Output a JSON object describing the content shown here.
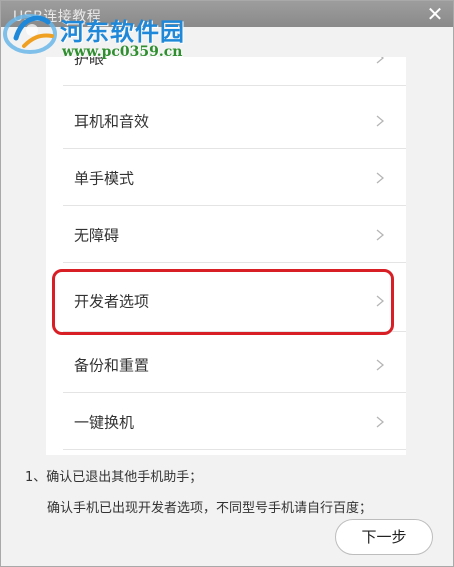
{
  "window": {
    "title": "USB连接教程",
    "close_glyph": "✕"
  },
  "watermark": {
    "title": "河东软件园",
    "url": "www.pc0359.cn"
  },
  "settings_list": [
    {
      "label": "护眼"
    },
    {
      "label": "耳机和音效"
    },
    {
      "label": "单手模式"
    },
    {
      "label": "无障碍"
    },
    {
      "label": "开发者选项"
    },
    {
      "label": "备份和重置"
    },
    {
      "label": "一键换机"
    }
  ],
  "highlight": {
    "target": "开发者选项",
    "color": "#d91f26"
  },
  "instructions": {
    "line1": "1、确认已退出其他手机助手；",
    "line2": "确认手机已出现开发者选项，不同型号手机请自行百度；"
  },
  "next_button": {
    "label": "下一步"
  },
  "icons": {
    "close": "close-icon",
    "chevron": "chevron-right-icon",
    "logo": "watermark-logo-icon"
  }
}
